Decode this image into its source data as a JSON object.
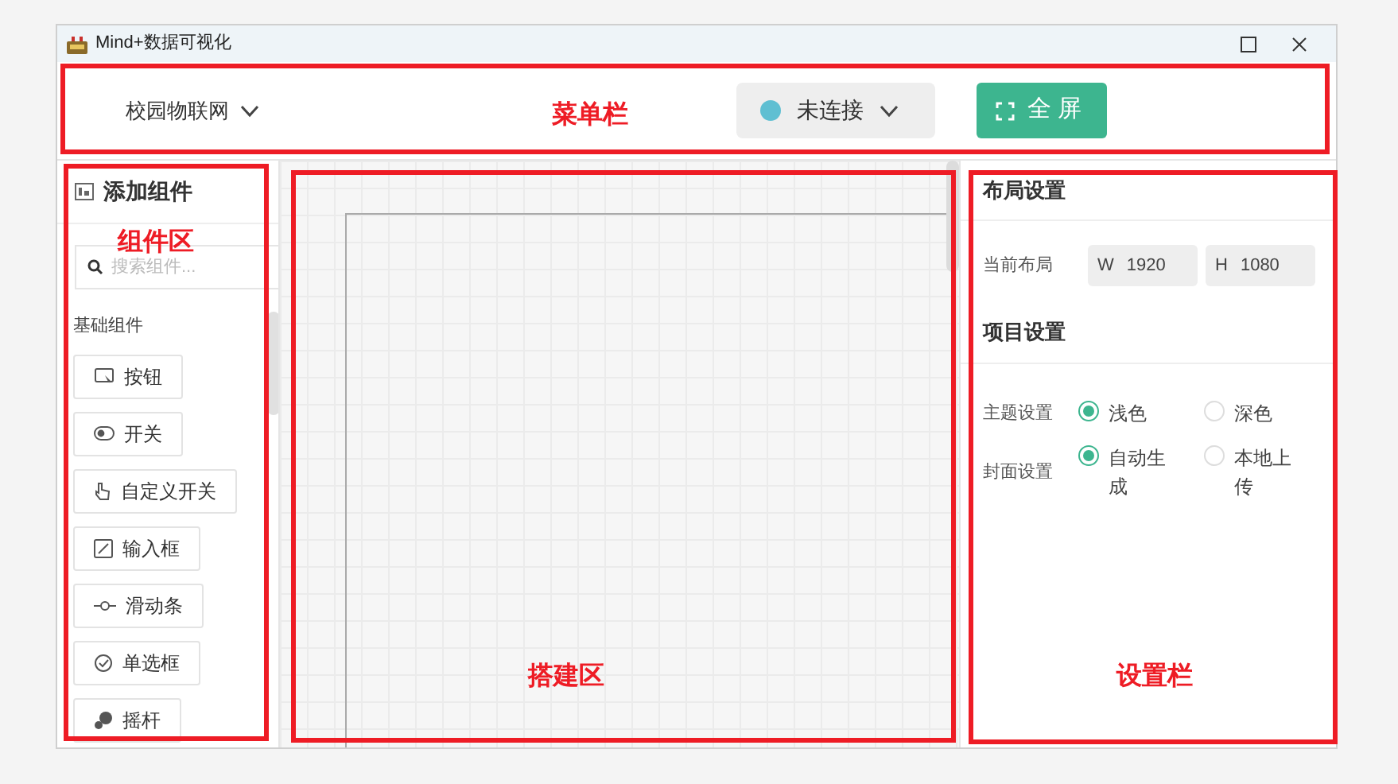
{
  "window": {
    "title": "Mind+数据可视化"
  },
  "menu_bar": {
    "project": "校园物联网",
    "connection": {
      "label": "未连接",
      "connected": false
    },
    "fullscreen": "全屏"
  },
  "components_panel": {
    "title": "添加组件",
    "search": {
      "placeholder": "搜索组件..."
    },
    "section": "基础组件",
    "items": [
      {
        "label": "按钮",
        "kind": "button"
      },
      {
        "label": "开关",
        "kind": "toggle"
      },
      {
        "label": "自定义开关",
        "kind": "hand"
      },
      {
        "label": "输入框",
        "kind": "input"
      },
      {
        "label": "滑动条",
        "kind": "slider"
      },
      {
        "label": "单选框",
        "kind": "radio"
      },
      {
        "label": "摇杆",
        "kind": "joystick"
      }
    ]
  },
  "settings_panel": {
    "layout_title": "布局设置",
    "layout_label": "当前布局",
    "width": {
      "prefix": "W",
      "value": "1920"
    },
    "height": {
      "prefix": "H",
      "value": "1080"
    },
    "project_title": "项目设置",
    "groups": [
      {
        "label": "主题设置",
        "options": [
          {
            "label": "浅色",
            "selected": true
          },
          {
            "label": "深色",
            "selected": false
          }
        ]
      },
      {
        "label": "封面设置",
        "options": [
          {
            "label": "自动生成",
            "selected": true
          },
          {
            "label": "本地上传",
            "selected": false
          }
        ]
      }
    ]
  },
  "annotations": [
    {
      "label": "菜单栏"
    },
    {
      "label": "组件区"
    },
    {
      "label": "搭建区"
    },
    {
      "label": "设置栏"
    }
  ]
}
